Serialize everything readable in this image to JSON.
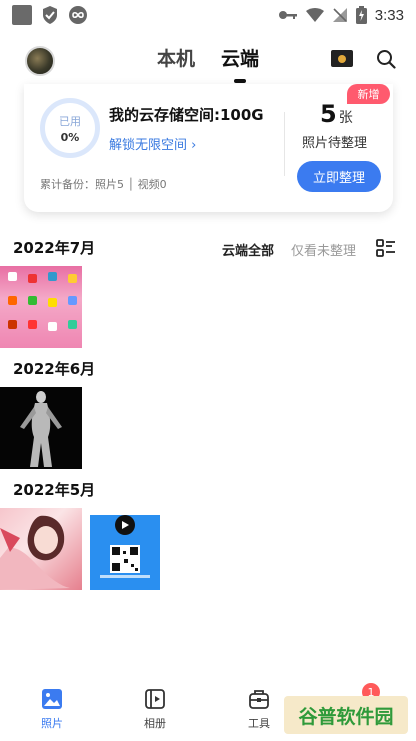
{
  "status_bar": {
    "time": "3:33",
    "icons": [
      "square-icon",
      "shield-check-icon",
      "infinity-icon",
      "key-icon",
      "wifi-icon",
      "no-signal-icon",
      "battery-charging-icon"
    ]
  },
  "header": {
    "tabs": [
      {
        "label": "本机",
        "active": false
      },
      {
        "label": "云端",
        "active": true
      }
    ]
  },
  "storage_card": {
    "used_label": "已用",
    "used_percent": "0%",
    "title": "我的云存储空间:100G",
    "unlock_link": "解锁无限空间 ›",
    "new_badge": "新增",
    "pending_count": "5",
    "pending_unit": "张",
    "pending_label": "照片待整理",
    "backup_summary": "累计备份：照片5 │ 视频0",
    "organize_button": "立即整理"
  },
  "filters": {
    "all": "云端全部",
    "unsorted": "仅看未整理"
  },
  "sections": [
    {
      "month": "2022年7月"
    },
    {
      "month": "2022年6月"
    },
    {
      "month": "2022年5月"
    }
  ],
  "bottom_nav": [
    {
      "label": "照片",
      "icon": "photo-icon",
      "active": true
    },
    {
      "label": "相册",
      "icon": "album-icon",
      "active": false
    },
    {
      "label": "工具",
      "icon": "toolbox-icon",
      "active": false
    }
  ],
  "nav_badge": "1",
  "watermark": "谷普软件园",
  "colors": {
    "accent": "#3b7bf0",
    "badge_red": "#ff5a6e",
    "link_blue": "#3a7ae0"
  }
}
